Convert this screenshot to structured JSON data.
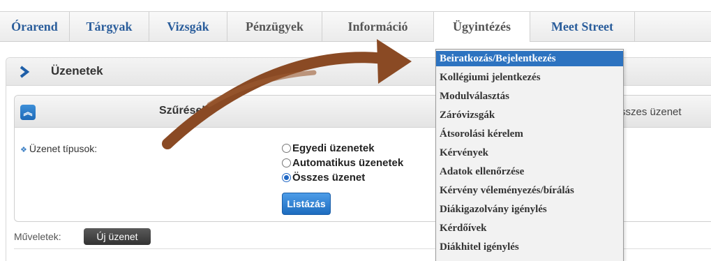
{
  "nav": {
    "items": [
      {
        "label": "Órarend",
        "style": "blue"
      },
      {
        "label": "Tárgyak",
        "style": "blue"
      },
      {
        "label": "Vizsgák",
        "style": "blue"
      },
      {
        "label": "Pénzügyek",
        "style": "gray"
      },
      {
        "label": "Információ",
        "style": "gray"
      },
      {
        "label": "Ügyintézés",
        "style": "gray",
        "active": true
      },
      {
        "label": "Meet Street",
        "style": "blue"
      }
    ]
  },
  "panel": {
    "title": "Üzenetek",
    "chevron_icon": "chevron-right-icon"
  },
  "filter": {
    "title": "Szűrések",
    "summary": "sszes üzenet",
    "collapse_icon": "double-chevron-up-icon",
    "type_label": "Üzenet típusok:",
    "options": [
      {
        "label": "Egyedi üzenetek",
        "checked": false
      },
      {
        "label": "Automatikus üzenetek",
        "checked": false
      },
      {
        "label": "Összes üzenet",
        "checked": true
      }
    ],
    "list_button": "Listázás"
  },
  "actions": {
    "label": "Műveletek:",
    "new_message_button": "Új üzenet"
  },
  "dropdown": {
    "items": [
      {
        "label": "Beiratkozás/Bejelentkezés",
        "highlighted": true
      },
      {
        "label": "Kollégiumi jelentkezés"
      },
      {
        "label": "Modulválasztás"
      },
      {
        "label": "Záróvizsgák"
      },
      {
        "label": "Átsorolási kérelem"
      },
      {
        "label": "Kérvények"
      },
      {
        "label": "Adatok ellenőrzése"
      },
      {
        "label": "Kérvény véleményezés/bírálás"
      },
      {
        "label": "Diákigazolvány igénylés"
      },
      {
        "label": "Kérdőívek"
      },
      {
        "label": "Diákhitel igénylés"
      }
    ]
  },
  "colors": {
    "nav_blue": "#2a5d9b",
    "accent_blue": "#2d73c0",
    "arrow_brown": "#8a4a24"
  }
}
